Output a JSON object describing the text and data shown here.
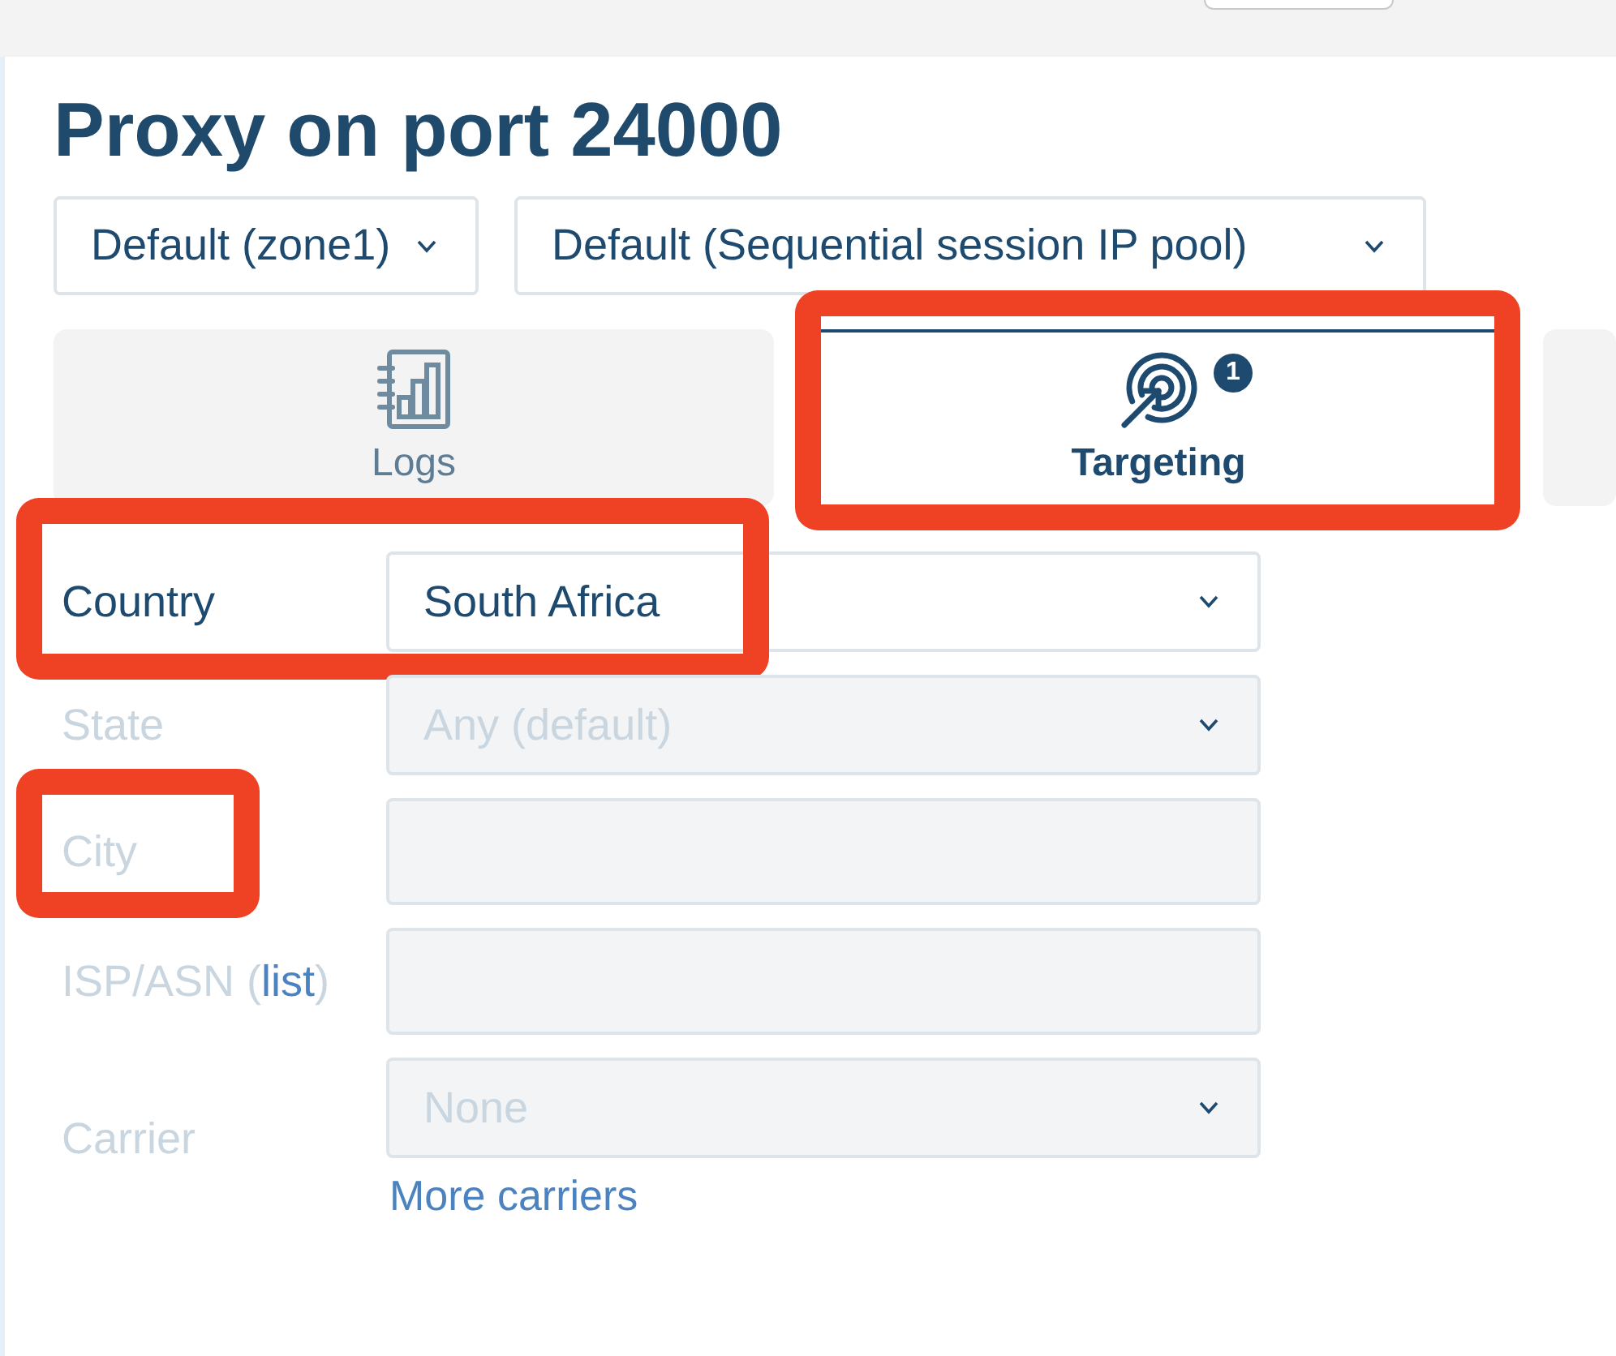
{
  "title": "Proxy on port 24000",
  "selectors": [
    {
      "value": "Default (zone1)"
    },
    {
      "value": "Default (Sequential session IP pool)"
    }
  ],
  "tabs": [
    {
      "label": "Logs",
      "selected": false,
      "highlighted": false
    },
    {
      "label": "Targeting",
      "selected": true,
      "highlighted": true,
      "badge": "1"
    },
    {
      "selected": false,
      "highlighted": false
    }
  ],
  "targeting": {
    "rows": [
      {
        "kind": "select",
        "label": "Country",
        "value": "South Africa",
        "disabled": false,
        "highlighted": true
      },
      {
        "kind": "select",
        "label": "State",
        "value": "Any (default)",
        "disabled": true,
        "highlighted": false
      },
      {
        "kind": "input",
        "label": "City",
        "disabled": true,
        "highlighted": true
      },
      {
        "kind": "input",
        "label": "ISP/ASN (",
        "link": "list",
        "label_suffix": ")",
        "disabled": true,
        "highlighted": false
      },
      {
        "kind": "select",
        "label": "Carrier",
        "value": "None",
        "disabled": true,
        "highlighted": false,
        "link_below": "More carriers"
      }
    ]
  }
}
